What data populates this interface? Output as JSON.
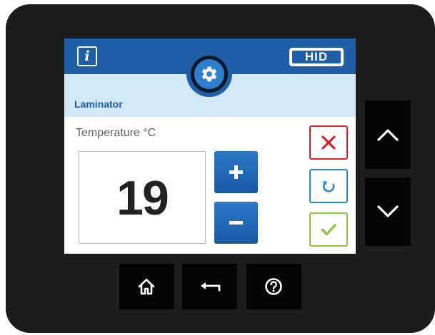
{
  "header": {
    "info_symbol": "i",
    "logo_text": "HID"
  },
  "screen": {
    "title": "Laminator",
    "parameter_label": "Temperature °C",
    "value": "19"
  },
  "icons": {
    "info": "info-icon",
    "settings": "gear-icon",
    "increase": "plus-icon",
    "decrease": "minus-icon",
    "cancel": "close-icon",
    "reset": "refresh-icon",
    "confirm": "check-icon",
    "up": "chevron-up-icon",
    "down": "chevron-down-icon",
    "home": "home-icon",
    "back": "back-arrow-icon",
    "help": "help-icon"
  },
  "colors": {
    "header_blue": "#1f5fa8",
    "title_band": "#d3e8f6",
    "cancel_red": "#d9212c",
    "reset_blue": "#2e86cf",
    "confirm_green": "#8cc63f",
    "bezel": "#1c1c1c"
  }
}
